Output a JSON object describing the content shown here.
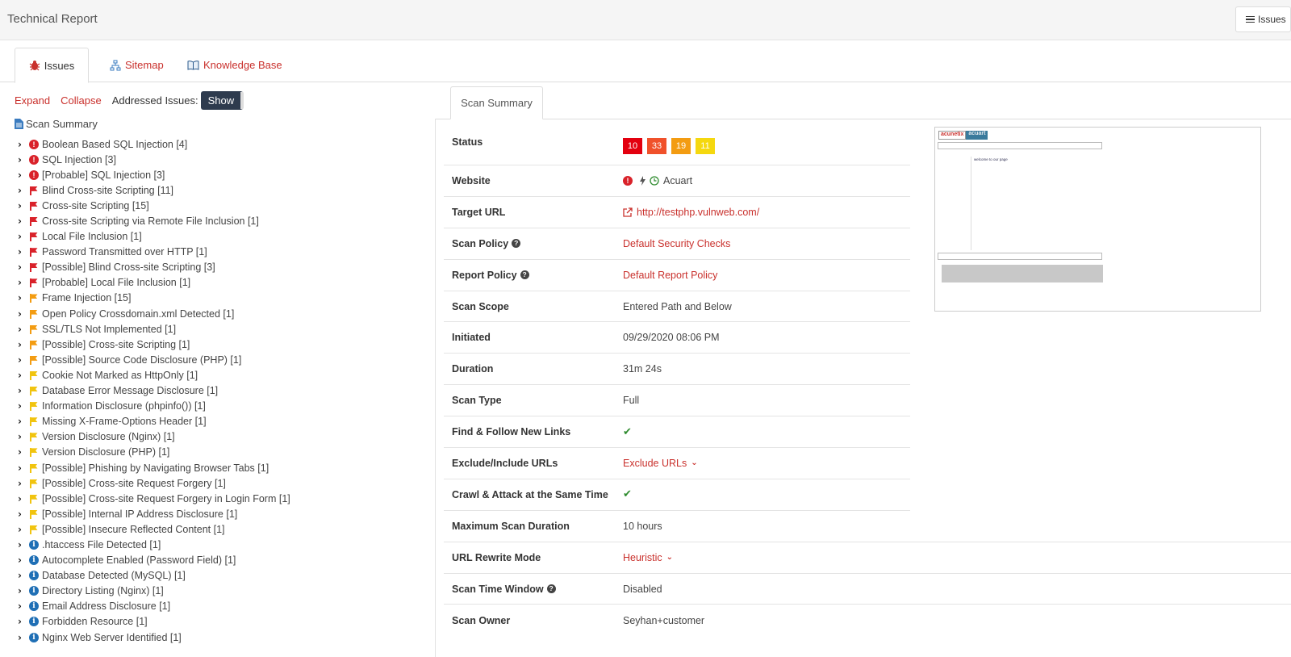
{
  "header": {
    "title": "Technical Report",
    "issues_button": "Issues"
  },
  "tabs": [
    {
      "label": "Issues",
      "icon": "bug-icon"
    },
    {
      "label": "Sitemap",
      "icon": "sitemap-icon"
    },
    {
      "label": "Knowledge Base",
      "icon": "book-icon"
    }
  ],
  "toolbar": {
    "expand": "Expand",
    "collapse": "Collapse",
    "addressed_label": "Addressed Issues:",
    "show": "Show"
  },
  "tree": {
    "root_label": "Scan Summary",
    "items": [
      {
        "sev": "high",
        "label": "Boolean Based SQL Injection [4]"
      },
      {
        "sev": "high",
        "label": "SQL Injection [3]"
      },
      {
        "sev": "high",
        "label": "[Probable] SQL Injection [3]"
      },
      {
        "sev": "critical",
        "label": "Blind Cross-site Scripting [11]"
      },
      {
        "sev": "critical",
        "label": "Cross-site Scripting [15]"
      },
      {
        "sev": "critical",
        "label": "Cross-site Scripting via Remote File Inclusion [1]"
      },
      {
        "sev": "critical",
        "label": "Local File Inclusion [1]"
      },
      {
        "sev": "critical",
        "label": "Password Transmitted over HTTP [1]"
      },
      {
        "sev": "critical",
        "label": "[Possible] Blind Cross-site Scripting [3]"
      },
      {
        "sev": "critical",
        "label": "[Probable] Local File Inclusion [1]"
      },
      {
        "sev": "medium",
        "label": "Frame Injection [15]"
      },
      {
        "sev": "medium",
        "label": "Open Policy Crossdomain.xml Detected [1]"
      },
      {
        "sev": "medium",
        "label": "SSL/TLS Not Implemented [1]"
      },
      {
        "sev": "medium",
        "label": "[Possible] Cross-site Scripting [1]"
      },
      {
        "sev": "medium",
        "label": "[Possible] Source Code Disclosure (PHP) [1]"
      },
      {
        "sev": "low",
        "label": "Cookie Not Marked as HttpOnly [1]"
      },
      {
        "sev": "low",
        "label": "Database Error Message Disclosure [1]"
      },
      {
        "sev": "low",
        "label": "Information Disclosure (phpinfo()) [1]"
      },
      {
        "sev": "low",
        "label": "Missing X-Frame-Options Header [1]"
      },
      {
        "sev": "low",
        "label": "Version Disclosure (Nginx) [1]"
      },
      {
        "sev": "low",
        "label": "Version Disclosure (PHP) [1]"
      },
      {
        "sev": "low",
        "label": "[Possible] Phishing by Navigating Browser Tabs [1]"
      },
      {
        "sev": "low",
        "label": "[Possible] Cross-site Request Forgery [1]"
      },
      {
        "sev": "low",
        "label": "[Possible] Cross-site Request Forgery in Login Form [1]"
      },
      {
        "sev": "low",
        "label": "[Possible] Internal IP Address Disclosure [1]"
      },
      {
        "sev": "low",
        "label": "[Possible] Insecure Reflected Content [1]"
      },
      {
        "sev": "info",
        "label": ".htaccess File Detected [1]"
      },
      {
        "sev": "info",
        "label": "Autocomplete Enabled (Password Field) [1]"
      },
      {
        "sev": "info",
        "label": "Database Detected (MySQL) [1]"
      },
      {
        "sev": "info",
        "label": "Directory Listing (Nginx) [1]"
      },
      {
        "sev": "info",
        "label": "Email Address Disclosure [1]"
      },
      {
        "sev": "info",
        "label": "Forbidden Resource [1]"
      },
      {
        "sev": "info",
        "label": "Nginx Web Server Identified [1]"
      }
    ]
  },
  "severity_colors": {
    "high": "#d9222a",
    "critical": "#d9222a",
    "medium": "#f39c12",
    "low": "#f1c40f",
    "info": "#1f6fb5"
  },
  "summary_tab": "Scan Summary",
  "summary": {
    "status_label": "Status",
    "badges": [
      {
        "count": "10",
        "color": "#e3000f"
      },
      {
        "count": "33",
        "color": "#f0512b"
      },
      {
        "count": "19",
        "color": "#f39c12"
      },
      {
        "count": "11",
        "color": "#f5d80f"
      }
    ],
    "website_label": "Website",
    "website_value": "Acuart",
    "target_label": "Target URL",
    "target_value": "http://testphp.vulnweb.com/",
    "policy_label": "Scan Policy",
    "policy_value": "Default Security Checks",
    "report_label": "Report Policy",
    "report_value": "Default Report Policy",
    "scope_label": "Scan Scope",
    "scope_value": "Entered Path and Below",
    "initiated_label": "Initiated",
    "initiated_value": "09/29/2020 08:06 PM",
    "duration_label": "Duration",
    "duration_value": "31m 24s",
    "type_label": "Scan Type",
    "type_value": "Full",
    "follow_label": "Find & Follow New Links",
    "exclude_label": "Exclude/Include URLs",
    "exclude_value": "Exclude URLs",
    "crawl_label": "Crawl & Attack at the Same Time",
    "max_label": "Maximum Scan Duration",
    "max_value": "10 hours",
    "rewrite_label": "URL Rewrite Mode",
    "rewrite_value": "Heuristic",
    "window_label": "Scan Time Window",
    "window_value": "Disabled",
    "owner_label": "Scan Owner",
    "owner_value": "Seyhan+customer"
  },
  "thumbnail": {
    "brand_a": "acunetix",
    "brand_b": "acuart",
    "heading": "welcome to our page"
  }
}
